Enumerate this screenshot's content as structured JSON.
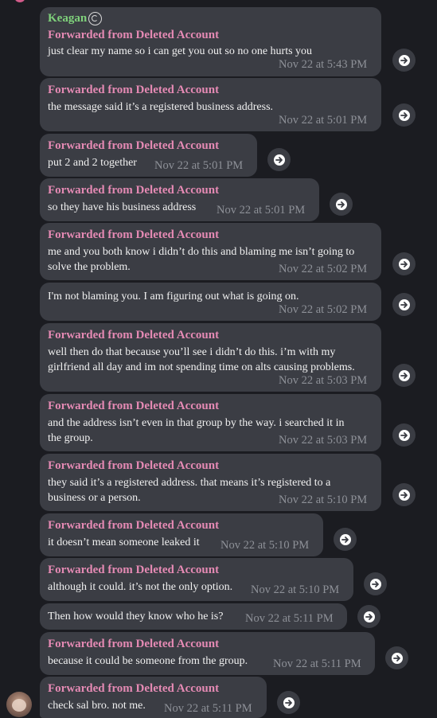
{
  "chat": {
    "sender_name": "Keagan",
    "forwarded_label": "Forwarded from Deleted Account",
    "messages": [
      {
        "lines": [
          "just clear my name so i can get you out so no one hurts you"
        ],
        "time": "Nov 22 at 5:43 PM"
      },
      {
        "lines": [
          "the message said it’s a registered business address."
        ],
        "time": "Nov 22 at 5:01 PM"
      },
      {
        "lines": [
          "put 2 and 2 together"
        ],
        "time": "Nov 22 at 5:01 PM"
      },
      {
        "lines": [
          "so they have his business address"
        ],
        "time": "Nov 22 at 5:01 PM"
      },
      {
        "lines": [
          "me and you both know i didn’t do this and blaming me isn’t going to",
          "solve the problem."
        ],
        "time": "Nov 22 at 5:02 PM"
      },
      {
        "lines": [
          "I'm not blaming you. I am figuring out what is going on."
        ],
        "time": "Nov 22 at 5:02 PM"
      },
      {
        "lines": [
          "well then do that because you’ll see i didn’t do this. i’m with my",
          "girlfriend all day and im not spending time on alts causing problems."
        ],
        "time": "Nov 22 at 5:03 PM"
      },
      {
        "lines": [
          "and the address isn’t even in that group by the way. i searched it in",
          "the group."
        ],
        "time": "Nov 22 at 5:03 PM"
      },
      {
        "lines": [
          "they said it’s a registered address. that means it’s registered to a",
          "business or a person."
        ],
        "time": "Nov 22 at 5:10 PM"
      },
      {
        "lines": [
          "it doesn’t mean someone leaked it"
        ],
        "time": "Nov 22 at 5:10 PM"
      },
      {
        "lines": [
          "although it could. it’s not the only option."
        ],
        "time": "Nov 22 at 5:10 PM"
      },
      {
        "lines": [
          "Then how would they know who he is?"
        ],
        "time": "Nov 22 at 5:11 PM"
      },
      {
        "lines": [
          "because it could be someone from the group."
        ],
        "time": "Nov 22 at 5:11 PM"
      },
      {
        "lines": [
          "check sal bro. not me."
        ],
        "time": "Nov 22 at 5:11 PM"
      }
    ]
  },
  "icons": {
    "share": "share-arrow-icon",
    "sender_badge": "swirl-badge-icon",
    "avatar": "user-avatar"
  },
  "colors": {
    "background": "#1b1c21",
    "bubble": "#3b3d44",
    "sender_name": "#7fd17b",
    "forwarded": "#e58ab4",
    "text": "#f1f1f1",
    "timestamp": "#8e9198"
  }
}
